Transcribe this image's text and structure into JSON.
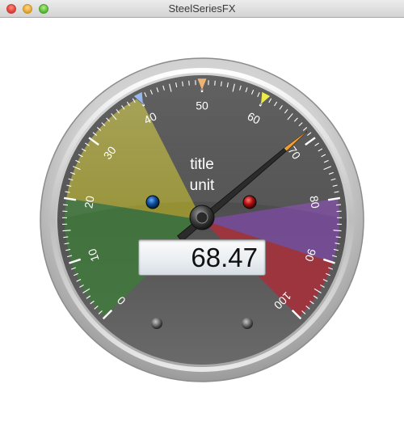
{
  "window": {
    "title": "SteelSeriesFX"
  },
  "gauge": {
    "title": "title",
    "unit": "unit",
    "value": 68.47,
    "value_text": "68.47",
    "min": 0,
    "max": 100,
    "scale_labels": [
      "0",
      "10",
      "20",
      "30",
      "40",
      "50",
      "60",
      "70",
      "80",
      "90",
      "100"
    ],
    "sections": [
      {
        "from": 0,
        "to": 20,
        "color": "#3e7a3a"
      },
      {
        "from": 20,
        "to": 40,
        "color": "#a8a12e"
      },
      {
        "from": 80,
        "to": 100,
        "color": "#7c4aa0"
      },
      {
        "from": 90,
        "to": 100,
        "color": "#a8302a"
      }
    ],
    "markers": [
      {
        "value": 40,
        "color": "#7fa6e8"
      },
      {
        "value": 50,
        "color": "#e8a052"
      },
      {
        "value": 60,
        "color": "#e6e61e"
      }
    ],
    "leds": [
      {
        "name": "user-led",
        "color": "#0d4f9c"
      },
      {
        "name": "threshold-led",
        "color": "#b01010"
      }
    ],
    "colors": {
      "frame": "#c0c0c0",
      "background": "#4a4a4a",
      "needle": "#2b2b2b",
      "needle_tip": "#f0a030",
      "tick": "#ffffff",
      "label": "#ffffff"
    }
  }
}
